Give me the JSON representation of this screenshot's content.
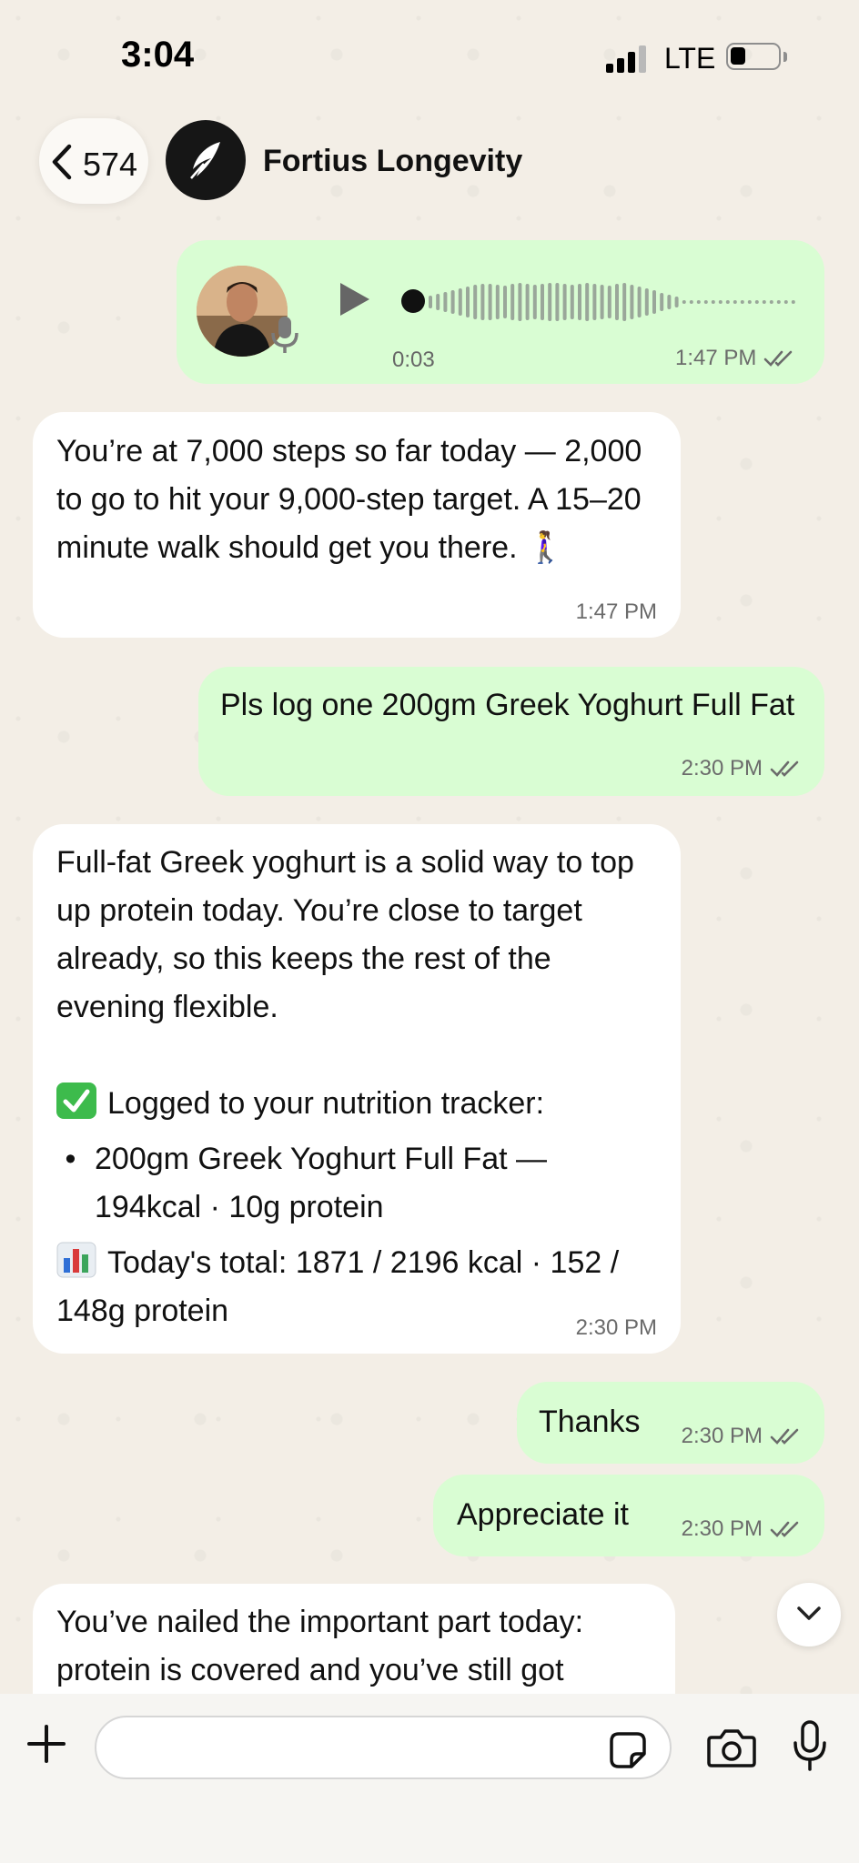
{
  "status_bar": {
    "time": "3:04",
    "network": "LTE"
  },
  "header": {
    "back_count": "574",
    "contact_name": "Fortius Longevity"
  },
  "messages": [
    {
      "type": "voice",
      "direction": "outgoing",
      "duration": "0:03",
      "time": "1:47 PM",
      "status_icon": "double-check-icon"
    },
    {
      "type": "text",
      "direction": "incoming",
      "text": "You’re at 7,000 steps so far today — 2,000 to go to hit your 9,000-step target. A 15–20 minute walk should get you there. 🚶‍♀️",
      "time": "1:47 PM"
    },
    {
      "type": "text",
      "direction": "outgoing",
      "text": "Pls log one 200gm Greek Yoghurt Full Fat",
      "time": "2:30 PM",
      "status_icon": "double-check-icon"
    },
    {
      "type": "text",
      "direction": "incoming",
      "intro": "Full-fat Greek yoghurt is a solid way to top up protein today. You’re close to target already, so this keeps the rest of the evening flexible.",
      "logged_label": "Logged to your nutrition tracker:",
      "logged_icon": "check-box-icon",
      "bullet": "200gm Greek Yoghurt Full Fat — 194kcal · 10g protein",
      "total": "Today's total: 1871 / 2196 kcal · 152 / 148g protein",
      "total_icon": "bar-chart-icon",
      "time": "2:30 PM"
    },
    {
      "type": "text",
      "direction": "outgoing",
      "text": "Thanks",
      "time": "2:30 PM",
      "status_icon": "double-check-icon"
    },
    {
      "type": "text",
      "direction": "outgoing",
      "text": "Appreciate it",
      "time": "2:30 PM",
      "status_icon": "double-check-icon"
    },
    {
      "type": "text",
      "direction": "incoming",
      "text": "You’ve nailed the important part today: protein is covered and you’ve still got"
    }
  ],
  "input_bar": {
    "placeholder": ""
  },
  "colors": {
    "outgoing_bubble": "#d9fdd3",
    "incoming_bubble": "#ffffff",
    "background": "#efeae2",
    "tick_color": "#6b6b6b"
  }
}
